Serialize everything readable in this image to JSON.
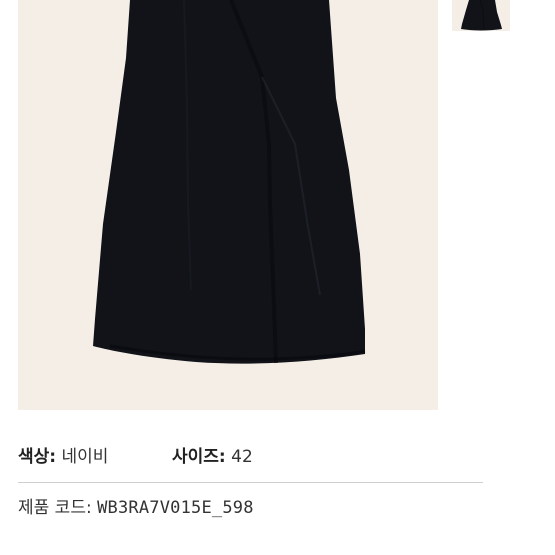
{
  "product": {
    "color_label": "색상:",
    "color_value": "네이비",
    "size_label": "사이즈:",
    "size_value": "42",
    "code_label": "제품 코드:",
    "code_value": "WB3RA7V015E_598"
  },
  "images": {
    "main_image_icon": "navy-skirt-image",
    "thumbnail_icon": "navy-skirt-thumbnail"
  },
  "colors": {
    "image_background": "#f4eee7",
    "garment": "#111319",
    "text": "#222222",
    "divider": "#cfcfcf"
  }
}
